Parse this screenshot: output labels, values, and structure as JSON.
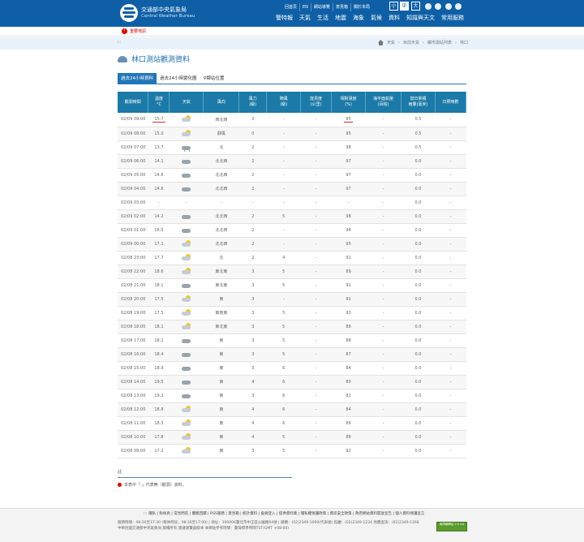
{
  "header": {
    "org_zh": "交通部中央氣象局",
    "org_en": "Central Weather Bureau",
    "util_links": [
      "回首頁",
      "EN",
      "網站導覽",
      "意見箱",
      "關於本局"
    ],
    "font_sizes": [
      "小",
      "中",
      "大"
    ],
    "nav": [
      "警特報",
      "天氣",
      "生活",
      "地震",
      "海象",
      "氣候",
      "資料",
      "知識與天文",
      "常用服務"
    ]
  },
  "alert": {
    "label": "重要地訊"
  },
  "breadcrumb": {
    "prefix": ":::",
    "items": [
      "天氣",
      "目前天氣",
      "鄉市測站列表",
      "林口"
    ]
  },
  "page": {
    "title": "林口測站觀測資料"
  },
  "tabs": [
    "過去24小時資料",
    "過去24小時變化圖",
    "鄰站位置"
  ],
  "colors": {
    "header_bg": "#0e5fa6",
    "table_header": "#1b7aa8",
    "tab_active": "#2276b8"
  },
  "table": {
    "headers": [
      "觀測時間",
      "溫度\n°C",
      "天氣",
      "風向",
      "風力\n(級)",
      "陣風\n(級)",
      "能見度\n(公里)",
      "相對濕度\n(%)",
      "海平面氣壓\n(百帕)",
      "當日累積\n雨量(毫米)",
      "日照時數"
    ],
    "rows": [
      [
        "02/09 09:00",
        "15.7",
        "partly-cloudy-icon",
        "西北西",
        "2",
        "-",
        "-",
        "95",
        "-",
        "0.5",
        "-"
      ],
      [
        "02/09 08:00",
        "15.0",
        "partly-cloudy-icon",
        "靜風",
        "0",
        "-",
        "-",
        "95",
        "-",
        "0.5",
        "-"
      ],
      [
        "02/09 07:00",
        "13.7",
        "rain-icon",
        "北",
        "2",
        "-",
        "-",
        "98",
        "-",
        "0.5",
        "-"
      ],
      [
        "02/09 06:00",
        "14.1",
        "cloudy-icon",
        "北北西",
        "2",
        "-",
        "-",
        "97",
        "-",
        "0.0",
        "-"
      ],
      [
        "02/09 05:00",
        "14.6",
        "cloudy-icon",
        "北北西",
        "2",
        "-",
        "-",
        "97",
        "-",
        "0.0",
        "-"
      ],
      [
        "02/09 04:00",
        "14.6",
        "cloudy-icon",
        "北北西",
        "2",
        "-",
        "-",
        "97",
        "-",
        "0.0",
        "-"
      ],
      [
        "02/09 03:00",
        "-",
        "-",
        "-",
        "-",
        "-",
        "-",
        "-",
        "-",
        "0.0",
        "-"
      ],
      [
        "02/09 02:00",
        "14.2",
        "cloudy-icon",
        "北北西",
        "2",
        "5",
        "-",
        "98",
        "-",
        "0.0",
        "-"
      ],
      [
        "02/09 01:00",
        "16.5",
        "cloudy-icon",
        "北北西",
        "2",
        "-",
        "-",
        "96",
        "-",
        "0.0",
        "-"
      ],
      [
        "02/09 00:00",
        "17.1",
        "partly-cloudy-icon",
        "北北西",
        "2",
        "-",
        "-",
        "95",
        "-",
        "0.0",
        "-"
      ],
      [
        "02/08 23:00",
        "17.7",
        "partly-cloudy-icon",
        "北",
        "2",
        "4",
        "-",
        "91",
        "-",
        "0.0",
        "-"
      ],
      [
        "02/08 22:00",
        "18.6",
        "partly-cloudy-icon",
        "東北東",
        "3",
        "5",
        "-",
        "89",
        "-",
        "0.0",
        "-"
      ],
      [
        "02/08 21:00",
        "18.1",
        "cloudy-icon",
        "東北東",
        "3",
        "5",
        "-",
        "91",
        "-",
        "0.0",
        "-"
      ],
      [
        "02/08 20:00",
        "17.5",
        "partly-cloudy-icon",
        "東",
        "3",
        "-",
        "-",
        "91",
        "-",
        "0.0",
        "-"
      ],
      [
        "02/08 19:00",
        "17.5",
        "partly-cloudy-icon",
        "東南東",
        "3",
        "5",
        "-",
        "93",
        "-",
        "0.0",
        "-"
      ],
      [
        "02/08 18:00",
        "18.1",
        "partly-cloudy-icon",
        "東北東",
        "3",
        "5",
        "-",
        "88",
        "-",
        "0.0",
        "-"
      ],
      [
        "02/08 17:00",
        "18.2",
        "cloudy-icon",
        "東",
        "3",
        "5",
        "-",
        "88",
        "-",
        "0.0",
        "-"
      ],
      [
        "02/08 16:00",
        "18.4",
        "cloudy-icon",
        "東",
        "3",
        "5",
        "-",
        "87",
        "-",
        "0.0",
        "-"
      ],
      [
        "02/08 15:00",
        "18.9",
        "cloudy-icon",
        "東",
        "3",
        "6",
        "-",
        "84",
        "-",
        "0.0",
        "-"
      ],
      [
        "02/08 14:00",
        "19.5",
        "cloudy-icon",
        "東",
        "4",
        "6",
        "-",
        "80",
        "-",
        "0.0",
        "-"
      ],
      [
        "02/08 13:00",
        "19.2",
        "cloudy-icon",
        "東",
        "3",
        "6",
        "-",
        "81",
        "-",
        "0.0",
        "-"
      ],
      [
        "02/08 12:00",
        "18.8",
        "partly-cloudy-icon",
        "東",
        "4",
        "6",
        "-",
        "84",
        "-",
        "0.0",
        "-"
      ],
      [
        "02/08 11:00",
        "18.5",
        "partly-cloudy-icon",
        "東",
        "4",
        "6",
        "-",
        "86",
        "-",
        "0.0",
        "-"
      ],
      [
        "02/08 10:00",
        "17.8",
        "partly-cloudy-icon",
        "東",
        "4",
        "5",
        "-",
        "88",
        "-",
        "0.0",
        "-"
      ],
      [
        "02/08 09:00",
        "17.2",
        "partly-cloudy-icon",
        "東",
        "3",
        "5",
        "-",
        "92",
        "-",
        "0.0",
        "-"
      ]
    ]
  },
  "notes": {
    "title": "註",
    "text": "本表中「-」代表無〔觀測〕資料。"
  },
  "footer": {
    "links": "::: 隱私 | 粉絲頁 | 常見問答 | 體驗回饋 | RSS服務 | 意見箱 | 統計資料 | 會員登入 | 提供資料集 | 隱私權保護政策 | 資訊安全政策 | 政府網站資料開放宣告 | 個人資料保護宣言",
    "address": "服務時間：08:30至17:30 (每休時段，08:30至17:00) | 地址：100006臺北市中正區公園路64號 | 總機：(02)2349-1000(代表號) 館廳：(02)2349-1234 地震查詢：(02)2349-1168",
    "copyright": "中華民國交通部中央氣象局 版權所有 建議瀏覽器版本 本網站參考時間：臺灣標準時間TST(GMT +08:00)",
    "badge": "無障礙網站 2.0 AA"
  }
}
